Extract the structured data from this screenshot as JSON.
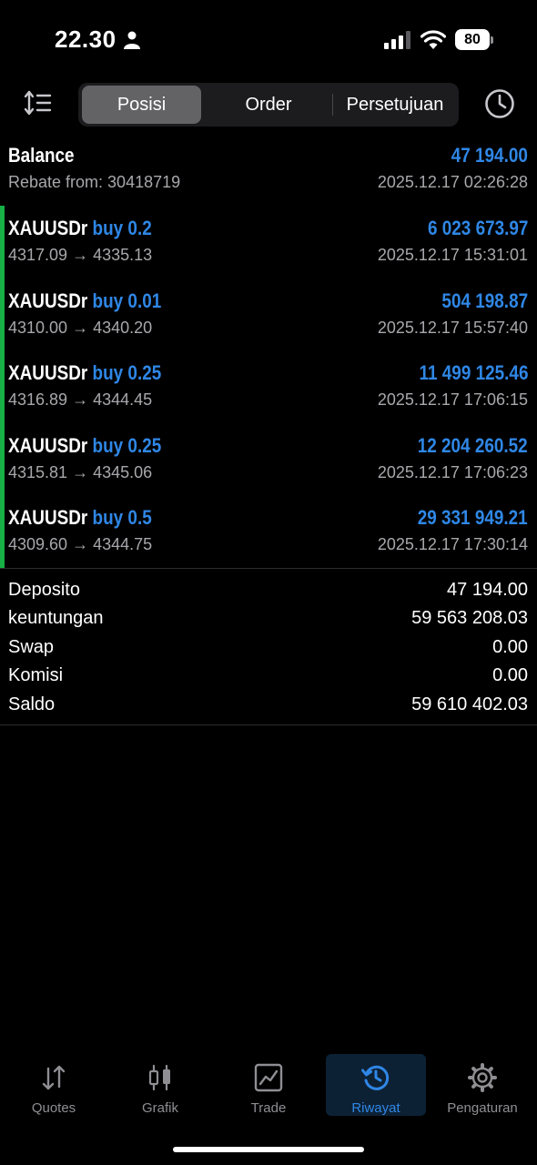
{
  "status_bar": {
    "time": "22.30",
    "battery": "80"
  },
  "toolbar": {
    "tabs": [
      {
        "label": "Posisi",
        "active": true
      },
      {
        "label": "Order",
        "active": false
      },
      {
        "label": "Persetujuan",
        "active": false
      }
    ],
    "icons": [
      "sort-icon",
      "history-clock-icon"
    ]
  },
  "history": {
    "balance": {
      "title": "Balance",
      "subtitle": "Rebate from: 30418719",
      "amount": "47 194.00",
      "time": "2025.12.17 02:26:28"
    },
    "deals": [
      {
        "symbol": "XAUUSDr",
        "action": "buy 0.2",
        "prices": "4317.09 → 4335.13",
        "profit": "6 023 673.97",
        "time": "2025.12.17 15:31:01"
      },
      {
        "symbol": "XAUUSDr",
        "action": "buy 0.01",
        "prices": "4310.00 → 4340.20",
        "profit": "504 198.87",
        "time": "2025.12.17 15:57:40"
      },
      {
        "symbol": "XAUUSDr",
        "action": "buy 0.25",
        "prices": "4316.89 → 4344.45",
        "profit": "11 499 125.46",
        "time": "2025.12.17 17:06:15"
      },
      {
        "symbol": "XAUUSDr",
        "action": "buy 0.25",
        "prices": "4315.81 → 4345.06",
        "profit": "12 204 260.52",
        "time": "2025.12.17 17:06:23"
      },
      {
        "symbol": "XAUUSDr",
        "action": "buy 0.5",
        "prices": "4309.60 → 4344.75",
        "profit": "29 331 949.21",
        "time": "2025.12.17 17:30:14"
      }
    ]
  },
  "summary": [
    {
      "label": "Deposito",
      "value": "47 194.00"
    },
    {
      "label": "keuntungan",
      "value": "59 563 208.03"
    },
    {
      "label": "Swap",
      "value": "0.00"
    },
    {
      "label": "Komisi",
      "value": "0.00"
    },
    {
      "label": "Saldo",
      "value": "59 610 402.03"
    }
  ],
  "tab_bar": [
    {
      "label": "Quotes",
      "icon": "quotes-arrows-icon",
      "active": false
    },
    {
      "label": "Grafik",
      "icon": "candlestick-chart-icon",
      "active": false
    },
    {
      "label": "Trade",
      "icon": "trade-chart-icon",
      "active": false
    },
    {
      "label": "Riwayat",
      "icon": "history-icon",
      "active": true
    },
    {
      "label": "Pengaturan",
      "icon": "gear-icon",
      "active": false
    }
  ],
  "colors": {
    "accent": "#2f87e6",
    "profit_bar": "#16b046",
    "background": "#000000"
  }
}
